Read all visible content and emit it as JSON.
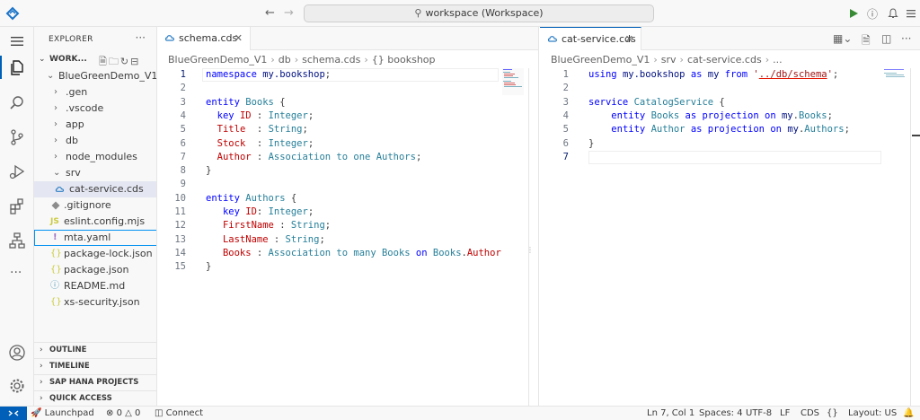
{
  "titlebar": {
    "search_text": "workspace (Workspace)"
  },
  "explorer": {
    "header": "EXPLORER",
    "workspace_label": "WORK...",
    "tree": [
      {
        "label": "BlueGreenDemo_V1",
        "type": "folder-open",
        "depth": 1
      },
      {
        "label": ".gen",
        "type": "folder",
        "depth": 2
      },
      {
        "label": ".vscode",
        "type": "folder",
        "depth": 2
      },
      {
        "label": "app",
        "type": "folder",
        "depth": 2
      },
      {
        "label": "db",
        "type": "folder",
        "depth": 2
      },
      {
        "label": "node_modules",
        "type": "folder",
        "depth": 2
      },
      {
        "label": "srv",
        "type": "folder-open",
        "depth": 2
      },
      {
        "label": "cat-service.cds",
        "type": "cds",
        "depth": 3
      },
      {
        "label": ".gitignore",
        "type": "git",
        "depth": 2
      },
      {
        "label": "eslint.config.mjs",
        "type": "js",
        "depth": 2
      },
      {
        "label": "mta.yaml",
        "type": "yaml",
        "depth": 2
      },
      {
        "label": "package-lock.json",
        "type": "json",
        "depth": 2
      },
      {
        "label": "package.json",
        "type": "json",
        "depth": 2
      },
      {
        "label": "README.md",
        "type": "info",
        "depth": 2
      },
      {
        "label": "xs-security.json",
        "type": "json",
        "depth": 2
      }
    ],
    "sections": [
      "OUTLINE",
      "TIMELINE",
      "SAP HANA PROJECTS",
      "QUICK ACCESS"
    ]
  },
  "editor_left": {
    "tab_label": "schema.cds",
    "breadcrumb": [
      "BlueGreenDemo_V1",
      "db",
      "schema.cds",
      "{} bookshop"
    ]
  },
  "editor_right": {
    "tab_label": "cat-service.cds",
    "breadcrumb": [
      "BlueGreenDemo_V1",
      "srv",
      "cat-service.cds",
      "..."
    ]
  },
  "statusbar": {
    "launchpad": "Launchpad",
    "errors": "0",
    "warnings": "0",
    "connect": "Connect",
    "position": "Ln 7, Col 1",
    "spaces": "Spaces: 4",
    "encoding": "UTF-8",
    "eol": "LF",
    "language": "CDS",
    "layout": "Layout: US"
  },
  "colors": {
    "accent": "#005fb8",
    "keyword": "#0000ff",
    "type": "#267f99",
    "property": "#c00000",
    "string": "#a31515"
  }
}
